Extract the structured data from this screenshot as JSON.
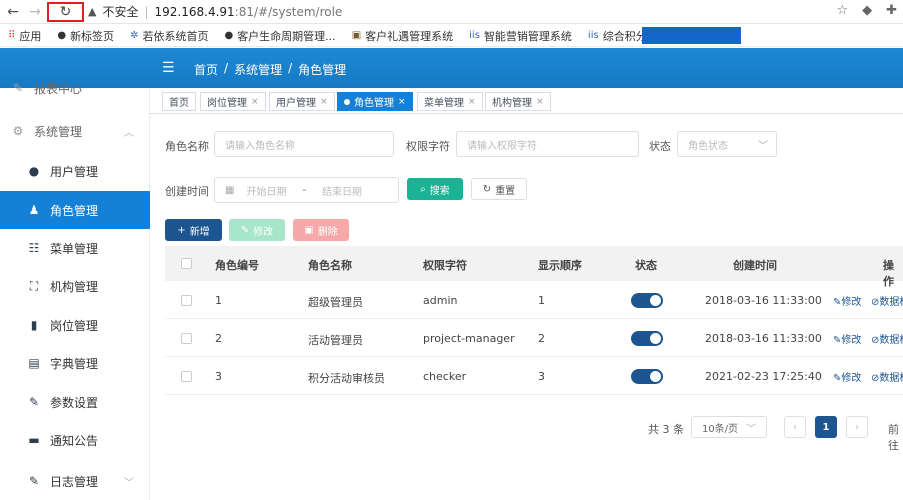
{
  "browser": {
    "back_icon": "arrow-left-icon",
    "forward_icon": "arrow-right-icon",
    "reload_icon": "reload-icon",
    "security": "不安全",
    "host": "192.168.4.91",
    "path": ":81/#/system/role",
    "bookmarks": [
      {
        "label": "应用"
      },
      {
        "label": "新标签页"
      },
      {
        "label": "若依系统首页"
      },
      {
        "label": "客户生命周期管理..."
      },
      {
        "label": "客户礼遇管理系统"
      },
      {
        "label": "智能营销管理系统"
      },
      {
        "label": "综合积分管理系统 [..."
      }
    ]
  },
  "header": {
    "breadcrumb": [
      "首页",
      "/",
      "系统管理",
      "/",
      "角色管理"
    ]
  },
  "sidebar": {
    "items": [
      {
        "label": "报表中心"
      },
      {
        "label": "系统管理"
      },
      {
        "label": "用户管理"
      },
      {
        "label": "角色管理"
      },
      {
        "label": "菜单管理"
      },
      {
        "label": "机构管理"
      },
      {
        "label": "岗位管理"
      },
      {
        "label": "字典管理"
      },
      {
        "label": "参数设置"
      },
      {
        "label": "通知公告"
      },
      {
        "label": "日志管理"
      }
    ]
  },
  "tabs": [
    {
      "label": "首页"
    },
    {
      "label": "岗位管理"
    },
    {
      "label": "用户管理"
    },
    {
      "label": "角色管理"
    },
    {
      "label": "菜单管理"
    },
    {
      "label": "机构管理"
    }
  ],
  "search": {
    "role_name_label": "角色名称",
    "role_name_placeholder": "请输入角色名称",
    "perm_label": "权限字符",
    "perm_placeholder": "请输入权限字符",
    "status_label": "状态",
    "status_placeholder": "角色状态",
    "created_label": "创建时间",
    "start_placeholder": "开始日期",
    "range_sep": "-",
    "end_placeholder": "结束日期",
    "search_btn": "搜索",
    "reset_btn": "重置"
  },
  "toolbar": {
    "add": "新增",
    "edit": "修改",
    "delete": "删除"
  },
  "table": {
    "columns": [
      "角色编号",
      "角色名称",
      "权限字符",
      "显示顺序",
      "状态",
      "创建时间",
      "操作"
    ],
    "rows": [
      {
        "id": "1",
        "name": "超级管理员",
        "key": "admin",
        "order": "1",
        "status": true,
        "created": "2018-03-16 11:33:00",
        "op_edit": "修改",
        "op_data": "数据权"
      },
      {
        "id": "2",
        "name": "活动管理员",
        "key": "project-manager",
        "order": "2",
        "status": true,
        "created": "2018-03-16 11:33:00",
        "op_edit": "修改",
        "op_data": "数据权"
      },
      {
        "id": "3",
        "name": "积分活动审核员",
        "key": "checker",
        "order": "3",
        "status": true,
        "created": "2021-02-23 17:25:40",
        "op_edit": "修改",
        "op_data": "数据权"
      }
    ]
  },
  "pagination": {
    "total": "共 3 条",
    "page_size": "10条/页",
    "current": "1",
    "jump": "前往"
  },
  "colors": {
    "primary": "#1480d8",
    "dark_blue": "#1c5590",
    "teal": "#1ab394"
  }
}
